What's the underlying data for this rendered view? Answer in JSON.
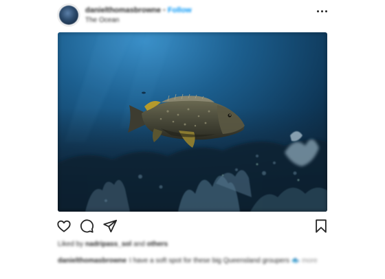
{
  "post": {
    "username": "danielthomasbrowne",
    "dot": "•",
    "follow_label": "Follow",
    "location": "The Ocean",
    "likes_prefix": "Liked by",
    "likes_user": "nadripass_sol",
    "likes_and": "and",
    "likes_others": "others",
    "caption_user": "danielthomasbrowne",
    "caption_text": "I have a soft spot for these big Queensland groupers 🐟",
    "caption_more": "more"
  },
  "icons": {
    "more": "more-dots-icon",
    "like": "heart-icon",
    "comment": "comment-icon",
    "share": "share-icon",
    "save": "bookmark-icon"
  },
  "colors": {
    "follow": "#0095f6",
    "text": "#262626",
    "muted": "#8e8e8e",
    "water_light": "#2f7fb8",
    "water_dark": "#0a1c2e"
  }
}
